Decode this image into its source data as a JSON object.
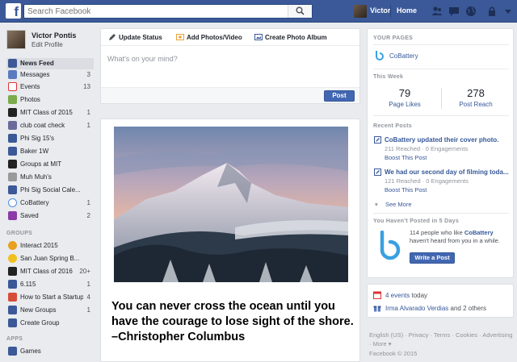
{
  "topbar": {
    "search_placeholder": "Search Facebook",
    "user_name": "Victor",
    "home_label": "Home"
  },
  "profile": {
    "name": "Victor Pontis",
    "edit_label": "Edit Profile"
  },
  "nav": {
    "favorites": [
      {
        "label": "News Feed",
        "count": ""
      },
      {
        "label": "Messages",
        "count": "3"
      },
      {
        "label": "Events",
        "count": "13"
      },
      {
        "label": "Photos",
        "count": ""
      },
      {
        "label": "MIT Class of 2015",
        "count": "1"
      },
      {
        "label": "club coat check",
        "count": "1"
      },
      {
        "label": "Phi Sig 15's",
        "count": ""
      },
      {
        "label": "Baker 1W",
        "count": ""
      },
      {
        "label": "Groups at MIT",
        "count": ""
      },
      {
        "label": "Muh Muh's",
        "count": ""
      },
      {
        "label": "Phi Sig Social Cale...",
        "count": ""
      },
      {
        "label": "CoBattery",
        "count": "1"
      },
      {
        "label": "Saved",
        "count": "2"
      }
    ],
    "groups_heading": "GROUPS",
    "groups": [
      {
        "label": "Interact 2015",
        "count": ""
      },
      {
        "label": "San Juan Spring B...",
        "count": ""
      },
      {
        "label": "MIT Class of 2016",
        "count": "20+"
      },
      {
        "label": "6.115",
        "count": "1"
      },
      {
        "label": "How to Start a Startup",
        "count": "4"
      },
      {
        "label": "New Groups",
        "count": "1"
      },
      {
        "label": "Create Group",
        "count": ""
      }
    ],
    "apps_heading": "APPS",
    "apps": [
      {
        "label": "Games",
        "count": ""
      }
    ]
  },
  "composer": {
    "tab_status": "Update Status",
    "tab_photo": "Add Photos/Video",
    "tab_album": "Create Photo Album",
    "placeholder": "What's on your mind?",
    "post_label": "Post"
  },
  "feed_post": {
    "quote": "You can never cross the ocean until you have the courage to lose sight of the shore. –Christopher Columbus"
  },
  "pages_card": {
    "heading": "YOUR PAGES",
    "page_name": "CoBattery",
    "this_week": "This Week",
    "page_likes_value": "79",
    "page_likes_label": "Page Likes",
    "post_reach_value": "278",
    "post_reach_label": "Post Reach",
    "recent_heading": "Recent Posts",
    "recent_posts": [
      {
        "title": "CoBattery updated their cover photo.",
        "meta": "211 Reached · 0 Engagements",
        "boost": "Boost This Post"
      },
      {
        "title": "We had our second day of filming toda...",
        "meta": "121 Reached · 0 Engagements",
        "boost": "Boost This Post"
      }
    ],
    "see_more": "See More",
    "inactive_heading": "You Haven't Posted in 5 Days",
    "nudge_pre": "114 people who like",
    "nudge_page": "CoBattery",
    "nudge_post": "haven't heard from you in a while.",
    "write_post": "Write a Post"
  },
  "events_card": {
    "events_count": "4 events",
    "events_suffix": "today",
    "birthday_name": "Irma Alvarado Verdias",
    "birthday_suffix": "and 2 others"
  },
  "footer": {
    "links": "English (US) · Privacy · Terms · Cookies · Advertising · More ▾",
    "copyright": "Facebook © 2015"
  },
  "colors": {
    "brand": "#3b5998",
    "link": "#365899",
    "button": "#4267b2"
  }
}
